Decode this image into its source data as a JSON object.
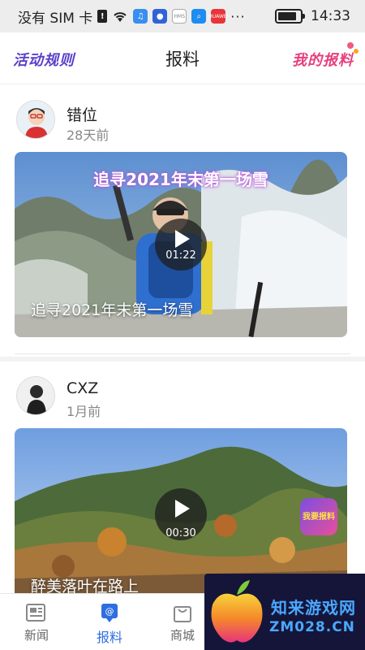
{
  "status_bar": {
    "carrier": "没有 SIM 卡",
    "time": "14:33",
    "battery_level": 0.85,
    "icons": [
      "sim-alert-icon",
      "wifi-icon",
      "music-app-icon",
      "baidu-app-icon",
      "hms-app-icon",
      "search-app-icon",
      "huawei-app-icon",
      "more-icon",
      "battery-icon"
    ]
  },
  "header": {
    "title": "报料",
    "left_button": "活动规则",
    "right_button": "我的报料"
  },
  "posts": [
    {
      "author": "错位",
      "time": "28天前",
      "overlay_title": "追寻2021年末第一场雪",
      "duration": "01:22",
      "caption": "追寻2021年末第一场雪"
    },
    {
      "author": "CXZ",
      "time": "1月前",
      "duration": "00:30",
      "caption": "醉美落叶在路上",
      "badge": "我要报料"
    }
  ],
  "bottom_nav": [
    {
      "label": "新闻",
      "icon": "newspaper-icon"
    },
    {
      "label": "报料",
      "icon": "report-icon",
      "active": true
    },
    {
      "label": "商城",
      "icon": "shopping-bag-icon"
    }
  ],
  "watermark": {
    "line1": "知来游戏网",
    "line2": "ZM028.CN"
  },
  "colors": {
    "accent_blue": "#2f6ee0",
    "rules_purple": "#5b3fc9",
    "my_reports_pink": "#e6407e"
  }
}
